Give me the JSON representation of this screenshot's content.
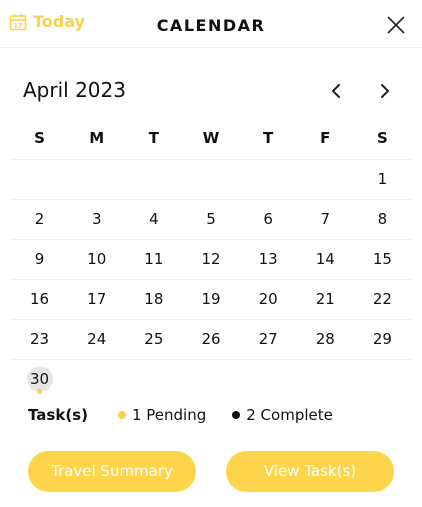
{
  "header": {
    "today_label": "Today",
    "title": "CALENDAR",
    "accent_color": "#F5D44A",
    "today_icon": "calendar-icon",
    "close_icon": "close-icon"
  },
  "calendar": {
    "month_label": "April 2023",
    "weekdays": [
      "S",
      "M",
      "T",
      "W",
      "T",
      "F",
      "S"
    ],
    "weeks": [
      [
        "",
        "",
        "",
        "",
        "",
        "",
        "1"
      ],
      [
        "2",
        "3",
        "4",
        "5",
        "6",
        "7",
        "8"
      ],
      [
        "9",
        "10",
        "11",
        "12",
        "13",
        "14",
        "15"
      ],
      [
        "16",
        "17",
        "18",
        "19",
        "20",
        "21",
        "22"
      ],
      [
        "23",
        "24",
        "25",
        "26",
        "27",
        "28",
        "29"
      ],
      [
        "30",
        "",
        "",
        "",
        "",
        "",
        ""
      ]
    ],
    "selected_day": "30",
    "days_with_tasks": [
      "30"
    ]
  },
  "legend": {
    "title": "Task(s)",
    "pending": "1 Pending",
    "complete": "2 Complete",
    "pending_color": "#F5D44A",
    "complete_color": "#111111"
  },
  "actions": {
    "travel_summary": "Travel Summary",
    "view_tasks": "View Task(s)"
  }
}
